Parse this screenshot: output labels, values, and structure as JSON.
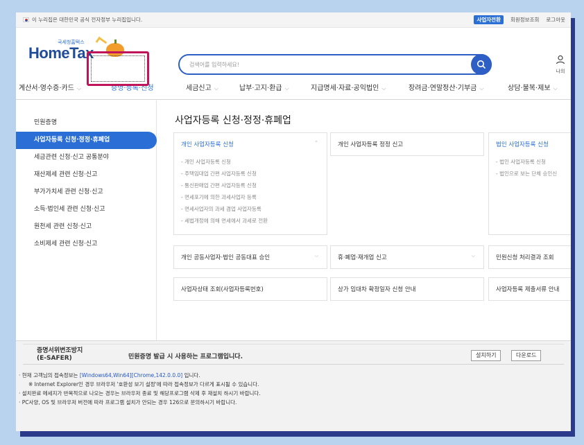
{
  "topbar": {
    "notice": "이 누리집은 대한민국 공식 전자정부 누리집입니다.",
    "business_pill": "사업자전환",
    "links": [
      "회원정보조회",
      "로그아웃"
    ]
  },
  "logo": {
    "sub": "국세청홈택스",
    "main": "HomeTax"
  },
  "search": {
    "placeholder": "검색어를 입력하세요!"
  },
  "user": {
    "label": "나의"
  },
  "gnb": {
    "items": [
      "계산서·영수증·카드",
      "증명·등록·신청",
      "세금신고",
      "납부·고지·환급",
      "지급명세·자료·공익법인",
      "장려금·연말정산·기부금",
      "상담·불복·제보"
    ]
  },
  "sidebar": {
    "items": [
      "민원증명",
      "사업자등록 신청·정정·휴폐업",
      "세금관련 신청·신고 공통분야",
      "재산제세 관련 신청·신고",
      "부가가치세 관련 신청·신고",
      "소득·법인세 관련 신청·신고",
      "원천세 관련 신청·신고",
      "소비제세 관련 신청·신고"
    ]
  },
  "main": {
    "title": "사업자등록 신청·정정·휴폐업",
    "cards": {
      "c1": {
        "title": "개인 사업자등록 신청",
        "items": [
          "개인 사업자등록 신청",
          "주택임대업 간편 사업자등록 신청",
          "통신판매업 간편 사업자등록 신청",
          "면세포기에 의한 과세사업자 등록",
          "면세사업자의 과세 겸업 사업자등록",
          "세법개정에 의해 면세에서 과세로 전환"
        ]
      },
      "c2": {
        "title": "개인 사업자등록 정정 신고"
      },
      "c3": {
        "title": "법인 사업자등록 신청",
        "items": [
          "법인 사업자등록 신청",
          "법인으로 보는 단체 승인신"
        ]
      },
      "c4": {
        "title": "개인 공동사업자·법인 공동대표 승인"
      },
      "c5": {
        "title": "휴·폐업·재개업 신고"
      },
      "c6": {
        "title": "민원신청 처리결과 조회"
      },
      "c7": {
        "title": "사업자상태 조회(사업자등록번호)"
      },
      "c8": {
        "title": "상가 임대차 확정일자 신청 안내"
      },
      "c9": {
        "title": "사업자등록 제출서류 안내"
      }
    }
  },
  "footer": {
    "esafer_name_1": "증명서위변조방지",
    "esafer_name_2": "(E-SAFER)",
    "esafer_desc": "민원증명 발급 시 사용하는 프로그램입니다.",
    "install": "설치하기",
    "download": "다운로드",
    "line1_pre": "현재 고객님의 접속정보는 ",
    "line1_link": "[Windows64,Win64][Chrome,142.0.0.0]",
    "line1_post": " 입니다.",
    "line2": "※ Internet Explorer인 경우 브라우저 '호환성 보기 설정'에 따라 접속정보가 다르게 표시될 수 있습니다.",
    "line3": "설치완료 메세지가 반복적으로 나오는 경우는 브라우저 종료 및 해당프로그램 삭제 후 재설치 하시기 바랍니다.",
    "line4": "PC사양, OS 및 브라우저 버전에 따라 프로그램 설치가 안되는 경우 126으로 문의하시기 바랍니다."
  },
  "colors": {
    "brand_blue": "#2b6fd6",
    "highlight": "#c0145a",
    "search_border": "#2d5fc4"
  }
}
